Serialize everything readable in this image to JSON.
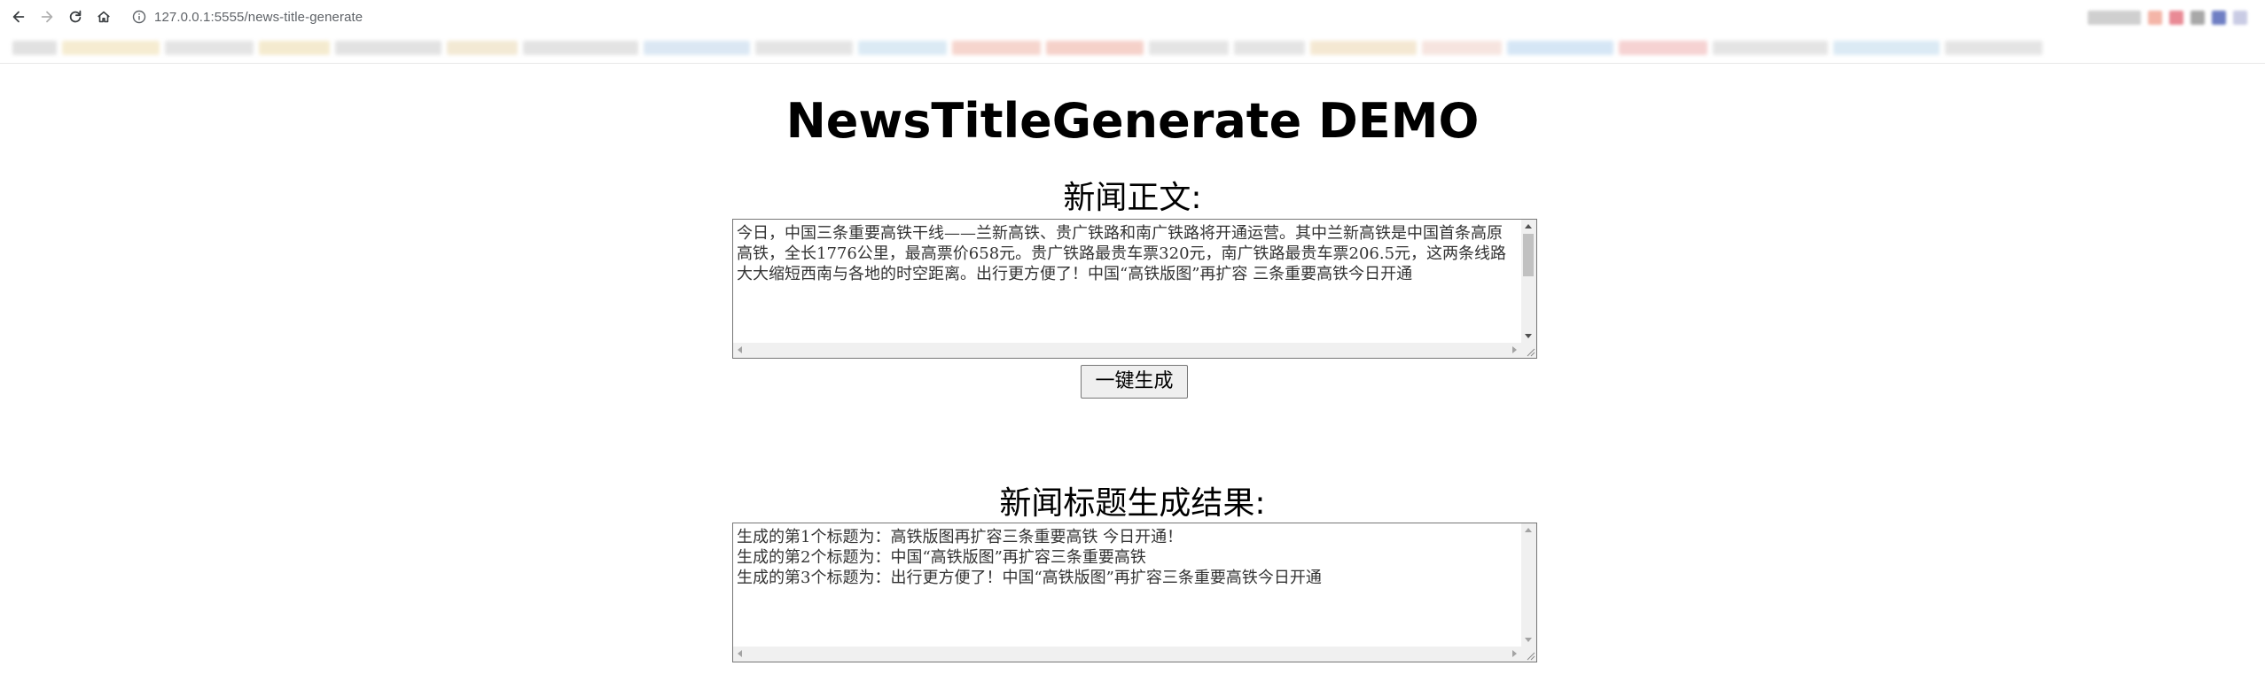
{
  "browser": {
    "url": "127.0.0.1:5555/news-title-generate",
    "icons": {
      "back": "arrow-left-icon",
      "forward": "arrow-right-icon",
      "reload": "reload-icon",
      "home": "home-icon",
      "site_info": "info-icon"
    }
  },
  "page": {
    "title": "NewsTitleGenerate DEMO",
    "body_label": "新闻正文:",
    "body_text": "今日，中国三条重要高铁干线——兰新高铁、贵广铁路和南广铁路将开通运营。其中兰新高铁是中国首条高原高铁，全长1776公里，最高票价658元。贵广铁路最贵车票320元，南广铁路最贵车票206.5元，这两条线路大大缩短西南与各地的时空距离。出行更方便了！中国“高铁版图”再扩容 三条重要高铁今日开通",
    "generate_button": "一键生成",
    "result_label": "新闻标题生成结果:",
    "result_text": "生成的第1个标题为：高铁版图再扩容三条重要高铁 今日开通！\n生成的第2个标题为：中国“高铁版图”再扩容三条重要高铁\n生成的第3个标题为：出行更方便了！中国“高铁版图”再扩容三条重要高铁今日开通"
  },
  "colors": {
    "text": "#000000",
    "textarea_text": "#333333",
    "button_bg": "#efefef",
    "border": "#767676"
  }
}
